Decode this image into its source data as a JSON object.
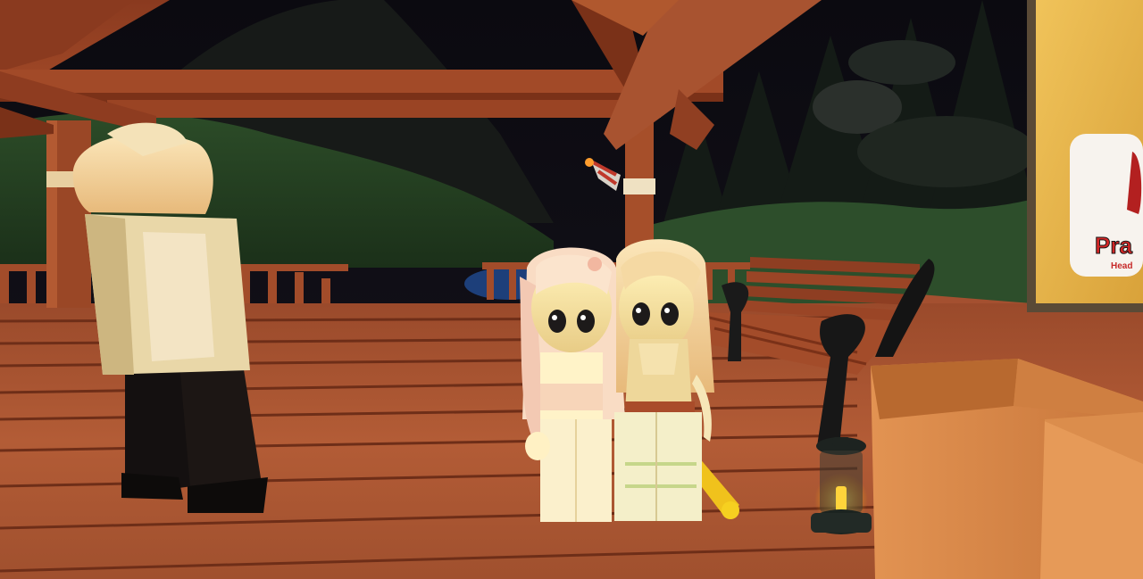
{
  "scene": {
    "setting": "night",
    "colors": {
      "sky": "#0d0b12",
      "hill": "#2a4a26",
      "wood_dark": "#6e2e18",
      "wood_mid": "#9c4a2a",
      "wood_light": "#b8623a",
      "bench": "#8e3e22",
      "box": "#d98a4c",
      "lantern_glow": "#ffd43b",
      "sign_board": "#e6b347"
    }
  },
  "sign": {
    "title_partial": "Pra",
    "subtitle_partial": "Head"
  }
}
